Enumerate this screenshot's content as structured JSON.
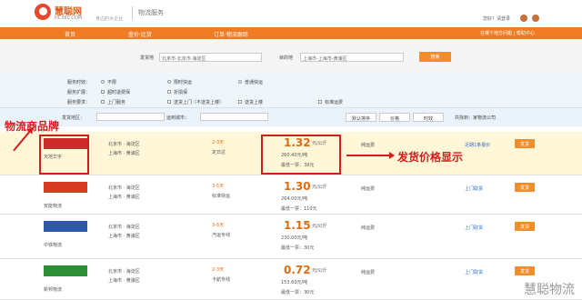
{
  "header": {
    "brand": "慧聪网",
    "site": "HC360.COM",
    "slogan": "身边的大企业",
    "section": "物流服务",
    "login": "您好！请登录"
  },
  "nav": {
    "items": [
      "首页",
      "查价·比货",
      "订单·物流跟踪"
    ],
    "help": "在哪个地方问题 | 帮助中心"
  },
  "search": {
    "from_label": "发货地",
    "from_value": "北京市-北京市-海淀区",
    "to_label": "目的地",
    "to_value": "上海市-上海市-黄浦区",
    "button": "搜索"
  },
  "filters": {
    "time_label": "服务时效：",
    "time_opts": [
      "不限",
      "限时快运",
      "普通快运"
    ],
    "extra_label": "服务扩展：",
    "extra_opts": [
      "超时退费保",
      "折损保"
    ],
    "pickup_label": "服务要求：",
    "pickup_opts": [
      "上门服务",
      "送货上门（不送货上楼）",
      "送货上楼",
      "标准运费"
    ]
  },
  "toolbar": {
    "origin": "发货地区：",
    "dest": "运到城市：",
    "sort_default": "默认排序",
    "sort_price": "价格",
    "sort_time": "时效",
    "total": "共找到：家物流公司"
  },
  "rows": [
    {
      "company": "天地华宇",
      "from_city": "北京市 · 海淀区",
      "to_city": "上海市 · 黄浦区",
      "time": "2-3天",
      "mode": "定日达",
      "price": "1.32",
      "unit": "元/公斤",
      "weight": "260.40元/吨",
      "min": "最低一票：39元",
      "service": "纯运费",
      "button": "发货",
      "more": "近期1条报价"
    },
    {
      "company": "安能物流",
      "from_city": "北京市 · 海淀区",
      "to_city": "上海市 · 黄浦区",
      "time": "3-5天",
      "mode": "标准快运",
      "price": "1.30",
      "unit": "元/公斤",
      "weight": "264.00元/吨",
      "min": "最低一票：110元",
      "service": "纯运费",
      "button": "发货",
      "more": "上门取货"
    },
    {
      "company": "中铁物流",
      "from_city": "北京市 · 海淀区",
      "to_city": "上海市 · 黄浦区",
      "time": "3-5天",
      "mode": "汽运专线",
      "price": "1.15",
      "unit": "元/公斤",
      "weight": "230.00元/吨",
      "min": "最低一票：30元",
      "service": "纯运费",
      "button": "发货",
      "more": "上门取货"
    },
    {
      "company": "新邦物流",
      "from_city": "北京市 · 海淀区",
      "to_city": "上海市 · 黄浦区",
      "time": "2-3天",
      "mode": "卡航专线",
      "price": "0.72",
      "unit": "元/公斤",
      "weight": "153.60元/吨",
      "min": "最低一票：30元",
      "service": "纯运费",
      "button": "发货",
      "more": "上门取货"
    }
  ],
  "annotations": {
    "brand_label": "物流商品牌",
    "price_label": "发货价格显示",
    "watermark": "慧聪物流"
  }
}
